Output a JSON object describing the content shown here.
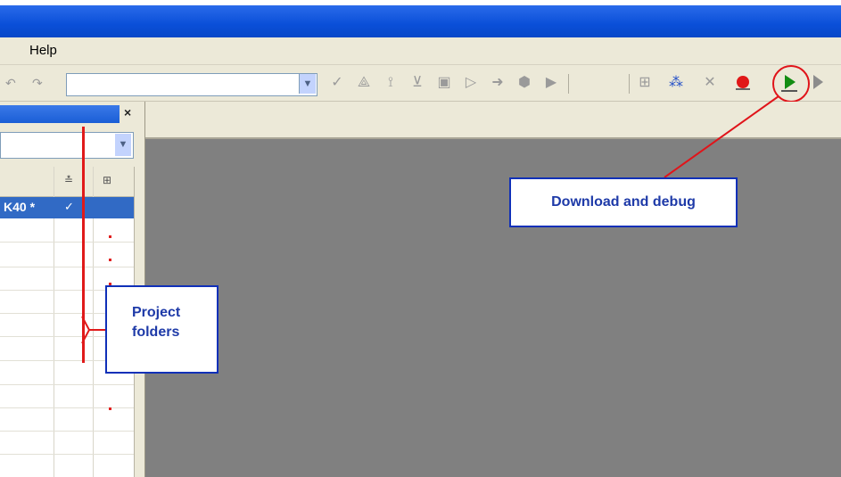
{
  "menu": {
    "help_label": "Help"
  },
  "toolbar": {
    "undo_icon": "undo-icon",
    "redo_icon": "redo-icon",
    "combo_value": "",
    "download_debug_icon": "download-debug-icon",
    "breakpoint_icon": "breakpoint-icon",
    "step_icon": "step-icon"
  },
  "panel": {
    "close_label": "×",
    "selected_row_text": "K40 *",
    "selected_row_check": "✓"
  },
  "callouts": {
    "download": "Download and debug",
    "project_line1": "Project",
    "project_line2": "folders"
  },
  "colors": {
    "titlebar": "#0a4fd8",
    "callout_border": "#1030b8",
    "callout_text": "#1e3aa8",
    "highlight": "#e0141a",
    "selection": "#316ac5"
  }
}
